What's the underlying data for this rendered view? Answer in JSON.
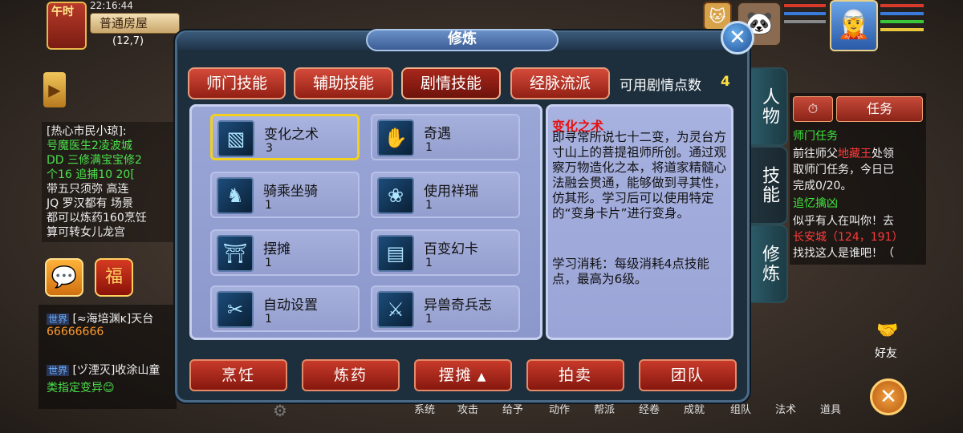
{
  "hud": {
    "time_label": "午时",
    "clock": "22:16:44",
    "room_name": "普通房屋",
    "room_coords": "(12,7)"
  },
  "chat": {
    "lines": [
      "[热心市民小琼]:",
      "号魔医生2凌波城",
      "DD 三修满宝宝修2",
      "个16  追捕10 20[",
      "带五只须弥 高连",
      "JQ 罗汉都有 场景",
      "都可以炼药160烹饪",
      "算可转女儿龙宫"
    ],
    "world_tag": "世界",
    "world_msg1_user": "[≈海培渊ĸ]天台",
    "world_msg1_text": "66666666",
    "world_msg2_user": "[ヅ湮灭]收涂山童",
    "world_msg2_text": "类指定变异😊",
    "chat_icon": "💬",
    "fu_icon": "福"
  },
  "right_tabs": [
    {
      "label": "人物"
    },
    {
      "label": "技能"
    },
    {
      "label": "修炼"
    }
  ],
  "quest": {
    "timer_icon": "⏱",
    "tab_label": "任务",
    "lines": [
      {
        "text": "师门任务",
        "color": "#3fe83f"
      },
      {
        "text": "前往师父",
        "color": "#f0f0f0"
      },
      {
        "text": "地藏王",
        "color": "#ff3a3a"
      },
      {
        "text": "处领",
        "color": "#f0f0f0"
      },
      {
        "text": "取师门任务，今日已",
        "color": "#f0f0f0"
      },
      {
        "text": "完成0/20。",
        "color": "#f0f0f0"
      },
      {
        "text": "追忆擒凶",
        "color": "#3fe83f"
      },
      {
        "text": "似乎有人在叫你！去",
        "color": "#f0f0f0"
      },
      {
        "text": "长安城（124，191）",
        "color": "#ff3a3a"
      },
      {
        "text": "找找这人是谁吧！（",
        "color": "#f0f0f0"
      }
    ]
  },
  "friend_label": "好友",
  "bottom_menu": [
    "系统",
    "攻击",
    "给予",
    "动作",
    "帮派",
    "经卷",
    "成就",
    "组队",
    "法术",
    "道具"
  ],
  "modal": {
    "title": "修炼",
    "close_icon": "✕",
    "tabs": [
      {
        "label": "师门技能"
      },
      {
        "label": "辅助技能"
      },
      {
        "label": "剧情技能"
      },
      {
        "label": "经脉流派"
      }
    ],
    "points_label": "可用剧情点数",
    "points_value": "4",
    "skills": [
      {
        "name": "变化之术",
        "level": "3",
        "icon": "▧"
      },
      {
        "name": "奇遇",
        "level": "1",
        "icon": "✋"
      },
      {
        "name": "骑乘坐骑",
        "level": "1",
        "icon": "♞"
      },
      {
        "name": "使用祥瑞",
        "level": "1",
        "icon": "❀"
      },
      {
        "name": "摆摊",
        "level": "1",
        "icon": "⛩"
      },
      {
        "name": "百变幻卡",
        "level": "1",
        "icon": "▤"
      },
      {
        "name": "自动设置",
        "level": "1",
        "icon": "✂"
      },
      {
        "name": "异兽奇兵志",
        "level": "1",
        "icon": "⚔"
      }
    ],
    "desc_title": "变化之术",
    "desc_body": "即寻常所说七十二变，为灵台方寸山上的菩提祖师所创。通过观察万物造化之本，将道家精髓心法融会贯通，能够做到寻其性，仿其形。学习后可以使用特定的“变身卡片”进行变身。",
    "desc_cost": "学习消耗：每级消耗4点技能点，最高为6级。",
    "actions": [
      {
        "label": "烹饪"
      },
      {
        "label": "炼药"
      },
      {
        "label": "摆摊"
      },
      {
        "label": "拍卖"
      },
      {
        "label": "团队"
      }
    ]
  },
  "colors": {
    "accent_red": "#c83a2a",
    "highlight_yellow": "#f2d020",
    "panel_lavender": "#9aa6d6"
  }
}
